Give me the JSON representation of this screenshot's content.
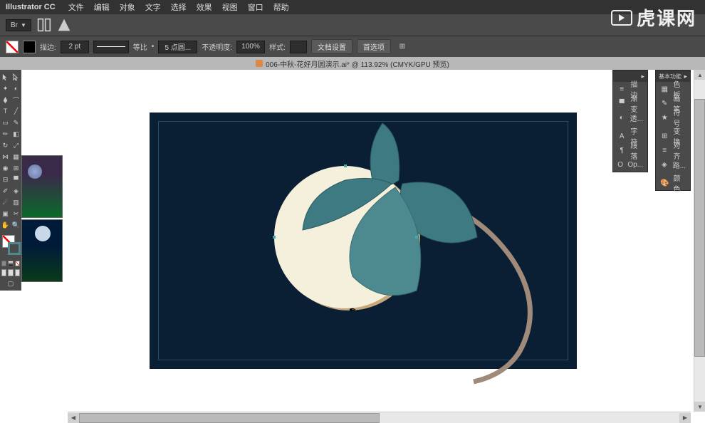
{
  "app": {
    "name": "Illustrator CC"
  },
  "menu": {
    "items": [
      "文件",
      "编辑",
      "对象",
      "文字",
      "选择",
      "效果",
      "视图",
      "窗口",
      "帮助"
    ]
  },
  "top_controls": {
    "dropdown": "Br"
  },
  "option_bar": {
    "stroke_label": "描边:",
    "stroke_weight": "2 pt",
    "stroke_profile": "等比",
    "brush_size": "5 点圆...",
    "opacity_label": "不透明度:",
    "opacity_value": "100%",
    "style_label": "样式:",
    "doc_setup": "文档设置",
    "prefs": "首选项"
  },
  "document": {
    "title": "006-中秋-花好月圆演示.ai* @ 113.92% (CMYK/GPU 预览)"
  },
  "panels": {
    "left_header": "",
    "left_items": [
      {
        "icon": "stroke",
        "label": "描边"
      },
      {
        "icon": "gradient",
        "label": "渐变"
      },
      {
        "icon": "transparency",
        "label": "透..."
      },
      {
        "icon": "character",
        "label": "字符"
      },
      {
        "icon": "paragraph",
        "label": "段落"
      },
      {
        "icon": "opentype",
        "label": "Op..."
      }
    ],
    "right_header": "基本功能",
    "right_items": [
      {
        "icon": "color",
        "label": "色板"
      },
      {
        "icon": "brushes",
        "label": "画笔"
      },
      {
        "icon": "symbols",
        "label": "符号"
      },
      {
        "icon": "transform",
        "label": "变换"
      },
      {
        "icon": "align",
        "label": "对齐"
      },
      {
        "icon": "pathfinder",
        "label": "路..."
      },
      {
        "icon": "swatches",
        "label": "颜色"
      }
    ]
  },
  "watermark": {
    "text": "虎课网"
  }
}
